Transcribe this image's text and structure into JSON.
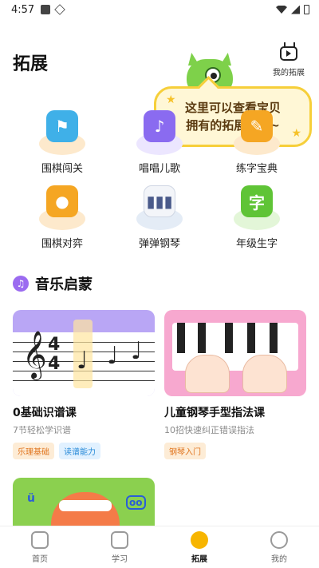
{
  "status_bar": {
    "time": "4:57"
  },
  "header": {
    "title": "拓展",
    "my_extension_label": "我的拓展"
  },
  "tooltip": {
    "line1": "这里可以查看宝贝",
    "line2": "拥有的拓展课哦~"
  },
  "features": [
    {
      "label": "围棋闯关",
      "icon": "go-level-icon",
      "color": "#3aa7e8"
    },
    {
      "label": "唱唱儿歌",
      "icon": "nursery-song-icon",
      "color": "#8a6bf0"
    },
    {
      "label": "练字宝典",
      "icon": "handwriting-icon",
      "color": "#f5a623"
    },
    {
      "label": "围棋对弈",
      "icon": "go-match-icon",
      "color": "#f5a623"
    },
    {
      "label": "弹弹钢琴",
      "icon": "piano-icon",
      "color": "#4a5a8a"
    },
    {
      "label": "年级生字",
      "icon": "grade-characters-icon",
      "color": "#5fc436"
    }
  ],
  "section": {
    "title": "音乐启蒙"
  },
  "courses": [
    {
      "title": "0基础识谱课",
      "subtitle": "7节轻松学识谱",
      "tags": [
        "乐理基础",
        "读谱能力"
      ]
    },
    {
      "title": "儿童钢琴手型指法课",
      "subtitle": "10招快速纠正错误指法",
      "tags": [
        "钢琴入门"
      ]
    }
  ],
  "nav": {
    "items": [
      {
        "label": "首页",
        "icon": "home-icon"
      },
      {
        "label": "学习",
        "icon": "study-icon"
      },
      {
        "label": "拓展",
        "icon": "extension-icon"
      },
      {
        "label": "我的",
        "icon": "profile-icon"
      }
    ],
    "active": "拓展"
  },
  "colors": {
    "accent": "#f7b500",
    "tooltip_border": "#f6cf3a",
    "section_icon": "#9b6bf0"
  }
}
